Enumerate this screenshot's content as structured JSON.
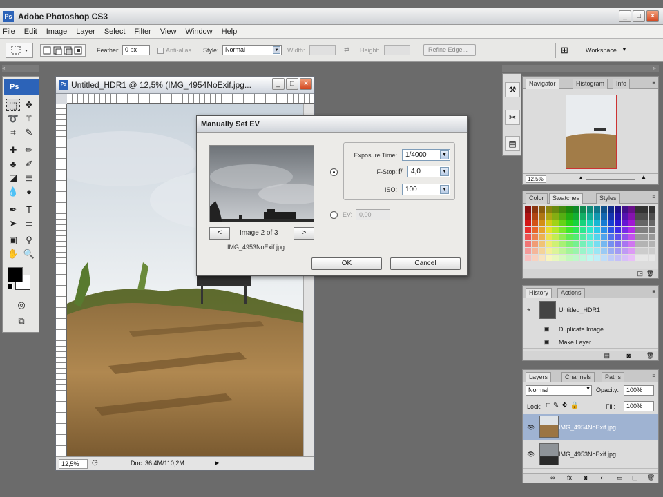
{
  "app": {
    "title": "Adobe Photoshop CS3",
    "logo": "Ps"
  },
  "menu": [
    "File",
    "Edit",
    "Image",
    "Layer",
    "Select",
    "Filter",
    "View",
    "Window",
    "Help"
  ],
  "options": {
    "feather_label": "Feather:",
    "feather_value": "0 px",
    "antialias_label": "Anti-alias",
    "style_label": "Style:",
    "style_value": "Normal",
    "width_label": "Width:",
    "height_label": "Height:",
    "refine_edge": "Refine Edge...",
    "workspace": "Workspace"
  },
  "document": {
    "title": "Untitled_HDR1 @ 12,5% (IMG_4954NoExif.jpg...",
    "zoom": "12,5%",
    "doc_info": "Doc: 36,4M/110,2M"
  },
  "dialog": {
    "title": "Manually Set EV",
    "image_counter": "Image 2 of 3",
    "filename": "IMG_4953NoExif.jpg",
    "exposure_label": "Exposure Time:",
    "exposure_value": "1/4000",
    "fstop_label": "F-Stop:",
    "fstop_prefix": "f/",
    "fstop_value": "4,0",
    "iso_label": "ISO:",
    "iso_value": "100",
    "ev_label": "EV:",
    "ev_value": "0,00",
    "prev": "<",
    "next": ">",
    "ok": "OK",
    "cancel": "Cancel"
  },
  "navigator": {
    "tabs": [
      "Navigator",
      "Histogram",
      "Info"
    ],
    "zoom": "12.5%"
  },
  "swatches": {
    "tabs": [
      "Color",
      "Swatches",
      "Styles"
    ]
  },
  "history": {
    "tabs": [
      "History",
      "Actions"
    ],
    "items": [
      "Untitled_HDR1",
      "Duplicate Image",
      "Make Layer"
    ]
  },
  "layers": {
    "tabs": [
      "Layers",
      "Channels",
      "Paths"
    ],
    "blend_mode": "Normal",
    "opacity_label": "Opacity:",
    "opacity_value": "100%",
    "lock_label": "Lock:",
    "fill_label": "Fill:",
    "fill_value": "100%",
    "items": [
      "IMG_4954NoExif.jpg",
      "IMG_4953NoExif.jpg"
    ]
  }
}
